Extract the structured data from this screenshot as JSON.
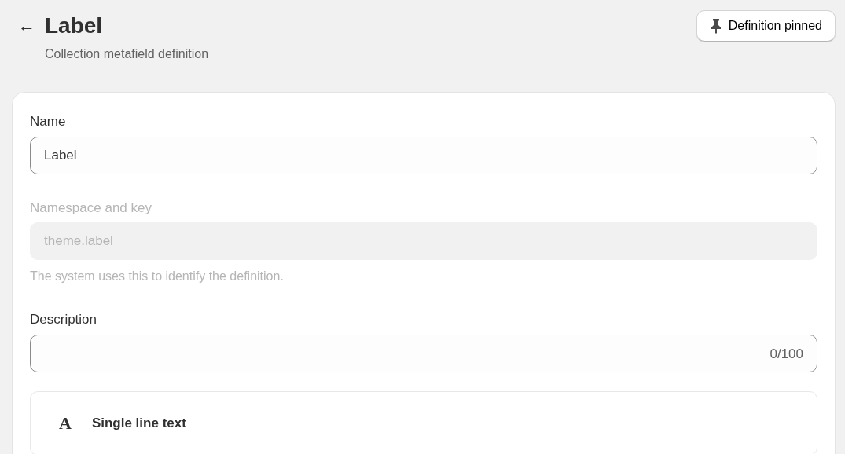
{
  "header": {
    "back_icon": "←",
    "title": "Label",
    "subtitle": "Collection metafield definition",
    "pin_button": {
      "label": "Definition pinned",
      "pinned": true
    }
  },
  "form": {
    "fields": [
      {
        "label": "Name",
        "value": "Label",
        "disabled": false
      },
      {
        "label": "Namespace and key",
        "value": "theme.label",
        "disabled": true,
        "help": "The system uses this to identify the definition."
      },
      {
        "label": "Description",
        "disabled": false,
        "counter": "0/100"
      }
    ],
    "type": {
      "icon": "A",
      "label": "Single line text"
    }
  }
}
